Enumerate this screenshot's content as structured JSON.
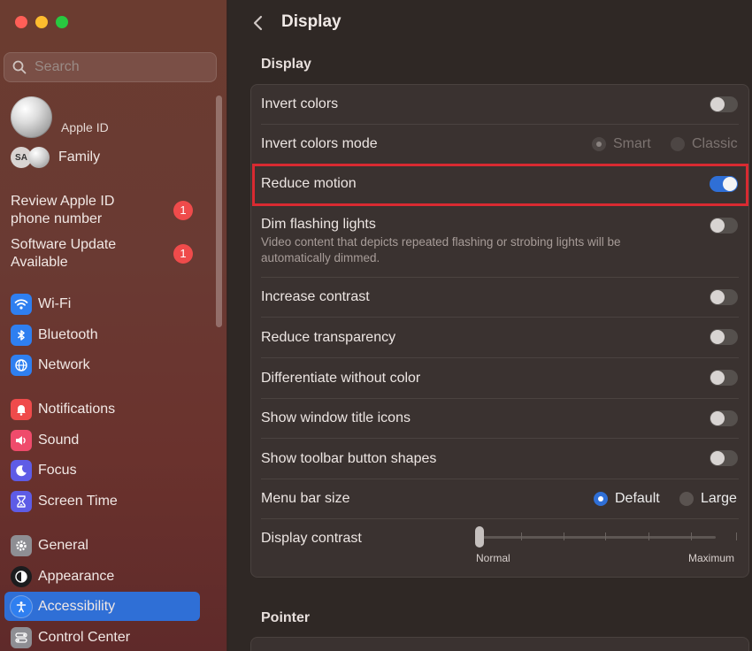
{
  "sidebar": {
    "search_placeholder": "Search",
    "apple_id_label": "Apple ID",
    "family_initials": "SA",
    "family_label": "Family",
    "alerts": [
      {
        "text": "Review Apple ID phone number",
        "badge": "1"
      },
      {
        "text": "Software Update Available",
        "badge": "1"
      }
    ],
    "items": [
      {
        "label": "Wi-Fi",
        "icon": "wifi-icon",
        "color": "#2f7ff0"
      },
      {
        "label": "Bluetooth",
        "icon": "bluetooth-icon",
        "color": "#2f7ff0"
      },
      {
        "label": "Network",
        "icon": "globe-icon",
        "color": "#2f7ff0"
      },
      {
        "label": "Notifications",
        "icon": "bell-icon",
        "color": "#ef4b4b"
      },
      {
        "label": "Sound",
        "icon": "speaker-icon",
        "color": "#ef4b6b"
      },
      {
        "label": "Focus",
        "icon": "moon-icon",
        "color": "#5e5ce6"
      },
      {
        "label": "Screen Time",
        "icon": "hourglass-icon",
        "color": "#5e5ce6"
      },
      {
        "label": "General",
        "icon": "gear-icon",
        "color": "#8e8e93"
      },
      {
        "label": "Appearance",
        "icon": "appearance-icon",
        "color": "#1c1c1e"
      },
      {
        "label": "Accessibility",
        "icon": "accessibility-icon",
        "color": "#2f7ff0",
        "selected": true
      },
      {
        "label": "Control Center",
        "icon": "control-center-icon",
        "color": "#8e8e93"
      }
    ]
  },
  "main": {
    "title": "Display",
    "section_display": "Display",
    "section_pointer": "Pointer",
    "rows": {
      "invert_colors": {
        "label": "Invert colors",
        "on": false
      },
      "invert_colors_mode": {
        "label": "Invert colors mode",
        "options": [
          "Smart",
          "Classic"
        ],
        "selected": "Smart"
      },
      "reduce_motion": {
        "label": "Reduce motion",
        "on": true
      },
      "dim_flashing": {
        "label": "Dim flashing lights",
        "description": "Video content that depicts repeated flashing or strobing lights will be automatically dimmed.",
        "on": false
      },
      "increase_contrast": {
        "label": "Increase contrast",
        "on": false
      },
      "reduce_transparency": {
        "label": "Reduce transparency",
        "on": false
      },
      "differentiate": {
        "label": "Differentiate without color",
        "on": false
      },
      "window_title_icons": {
        "label": "Show window title icons",
        "on": false
      },
      "toolbar_shapes": {
        "label": "Show toolbar button shapes",
        "on": false
      },
      "menu_bar_size": {
        "label": "Menu bar size",
        "options": [
          "Default",
          "Large"
        ],
        "selected": "Default"
      },
      "display_contrast": {
        "label": "Display contrast",
        "min_label": "Normal",
        "max_label": "Maximum",
        "value": 0
      }
    }
  },
  "colors": {
    "accent": "#2f6fd6",
    "highlight": "#d82a31"
  }
}
